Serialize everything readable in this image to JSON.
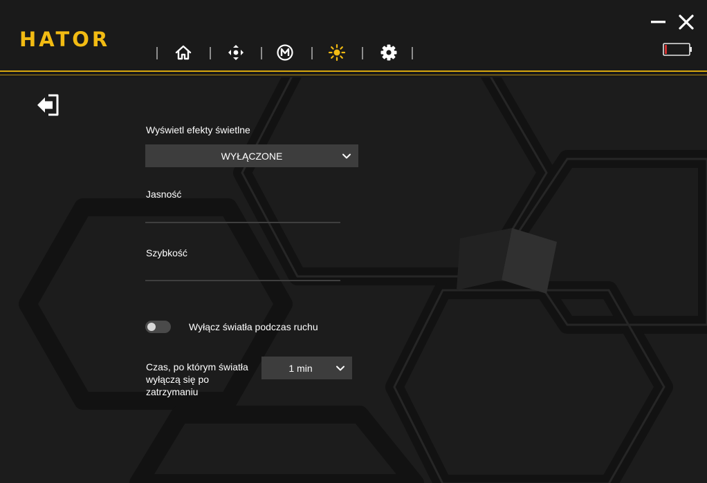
{
  "app": {
    "brand": "HATOR"
  },
  "nav": {
    "active": "lighting",
    "accent": "#f2bb13",
    "items": [
      {
        "id": "home",
        "icon": "home-icon"
      },
      {
        "id": "dpad",
        "icon": "dpad-icon"
      },
      {
        "id": "macro",
        "icon": "macro-m-icon"
      },
      {
        "id": "lighting",
        "icon": "sun-icon"
      },
      {
        "id": "settings",
        "icon": "gear-icon"
      }
    ]
  },
  "window": {
    "minimize_icon": "minimize-icon",
    "close_icon": "close-icon",
    "battery_icon": "battery-low-icon",
    "battery_color": "#d03030"
  },
  "lighting": {
    "effect_label": "Wyświetl efekty świetlne",
    "effect_value": "WYŁĄCZONE",
    "brightness_label": "Jasność",
    "speed_label": "Szybkość",
    "motion_toggle_label": "Wyłącz światła podczas ruchu",
    "motion_toggle_on": false,
    "timeout_label": "Czas, po którym światła wyłączą się po zatrzymaniu",
    "timeout_value": "1 min"
  },
  "theme": {
    "accent": "#f2bb13",
    "background": "#1c1c1c",
    "control_bg": "#3d3d3d"
  }
}
